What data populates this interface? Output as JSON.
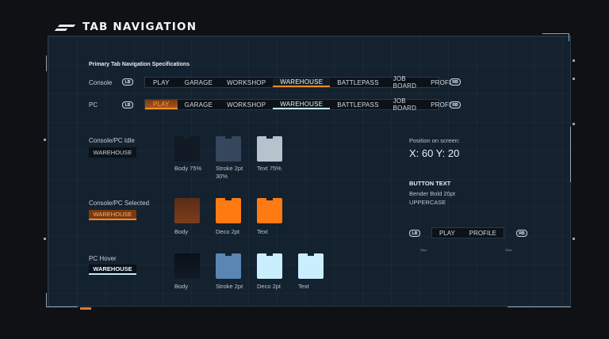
{
  "header": {
    "title": "TAB NAVIGATION"
  },
  "section": {
    "heading": "Primary Tab Navigation Specifications"
  },
  "rows": {
    "console": {
      "label": "Console",
      "lb": "LB",
      "rb": "RB",
      "tabs": [
        "PLAY",
        "GARAGE",
        "WORKSHOP",
        "WAREHOUSE",
        "BATTLEPASS",
        "JOB BOARD",
        "PROFILE"
      ]
    },
    "pc": {
      "label": "PC",
      "lb": "LB",
      "rb": "RB",
      "tabs": [
        "PLAY",
        "GARAGE",
        "WORKSHOP",
        "WAREHOUSE",
        "BATTLEPASS",
        "JOB BOARD",
        "PROFILE"
      ]
    }
  },
  "states": {
    "idle": {
      "label": "Console/PC Idle",
      "button": "WAREHOUSE",
      "swatches": [
        {
          "label": "Body 75%",
          "color": "#111a24"
        },
        {
          "label": "Stroke 2pt 30%",
          "color": "#34475c"
        },
        {
          "label": "Text 75%",
          "color": "#b5c3cc"
        }
      ]
    },
    "selected": {
      "label": "Console/PC Selected",
      "button": "WAREHOUSE",
      "swatches": [
        {
          "label": "Body",
          "color": "#6a3418"
        },
        {
          "label": "Deco 2pt",
          "color": "#ff7a12"
        },
        {
          "label": "Text",
          "color": "#ff7a12"
        }
      ]
    },
    "hover": {
      "label": "PC Hover",
      "button": "WAREHOUSE",
      "swatches": [
        {
          "label": "Body",
          "color": "#0a1017"
        },
        {
          "label": "Stroke 2pt",
          "color": "#5a86b4"
        },
        {
          "label": "Deco 2pt",
          "color": "#c9efff"
        },
        {
          "label": "Text",
          "color": "#c9efff"
        }
      ]
    }
  },
  "info": {
    "position_label": "Position on screen:",
    "coords": "X: 60 Y: 20",
    "button_text_heading": "BUTTON TEXT",
    "font_spec": "Bender Bold 20pt",
    "case_spec": "UPPERCASE"
  },
  "mini": {
    "lb": "LB",
    "rb": "RB",
    "tabs": [
      "PLAY",
      "PROFILE"
    ],
    "left_px": "36px",
    "right_px": "36px"
  },
  "colors": {
    "accent_orange": "#ff8a1f",
    "accent_ice": "#bfe9ff",
    "panel_bg": "#14212f",
    "page_bg": "#0f1115"
  },
  "icons": {
    "title": "double-stripe-icon",
    "shoulder_left": "lb-button-icon",
    "shoulder_right": "rb-button-icon"
  }
}
